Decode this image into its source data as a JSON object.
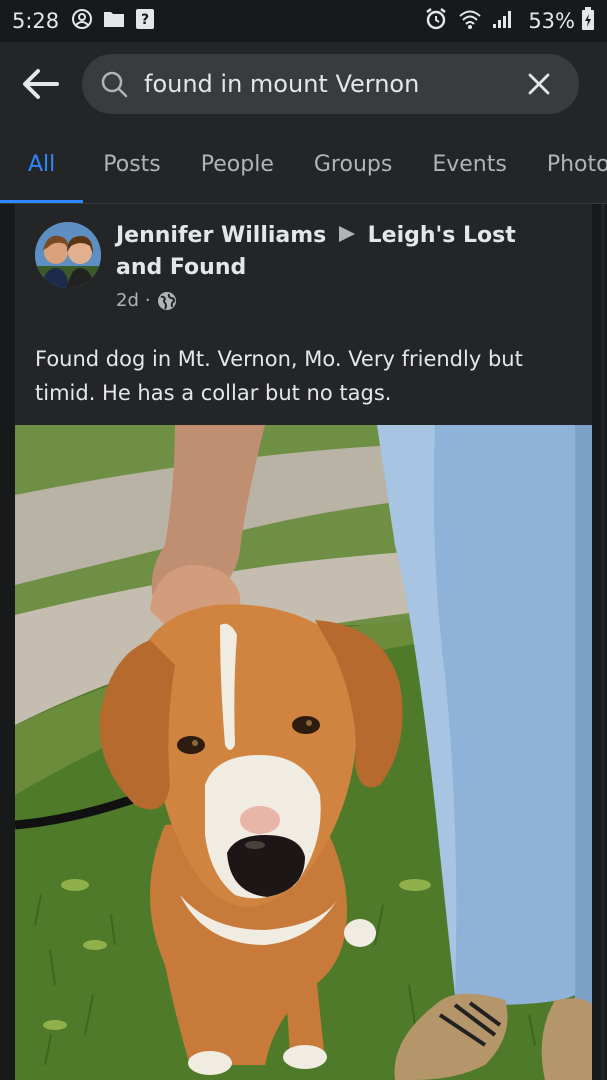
{
  "status_bar": {
    "time": "5:28",
    "battery": "53%"
  },
  "search": {
    "query": "found in mount Vernon"
  },
  "tabs": [
    {
      "label": "All",
      "active": true
    },
    {
      "label": "Posts",
      "active": false
    },
    {
      "label": "People",
      "active": false
    },
    {
      "label": "Groups",
      "active": false
    },
    {
      "label": "Events",
      "active": false
    },
    {
      "label": "Photos",
      "active": false
    }
  ],
  "post": {
    "author": "Jennifer Williams",
    "group": "Leigh's Lost and Found",
    "time": "2d",
    "separator": "·",
    "audience_icon": "globe-icon",
    "text": "Found dog in Mt. Vernon, Mo. Very friendly but timid. He has a collar but no tags."
  },
  "colors": {
    "background": "#18191a",
    "surface": "#242526",
    "accent": "#2d88ff",
    "text_primary": "#e4e6eb",
    "text_secondary": "#b0b3b8"
  }
}
